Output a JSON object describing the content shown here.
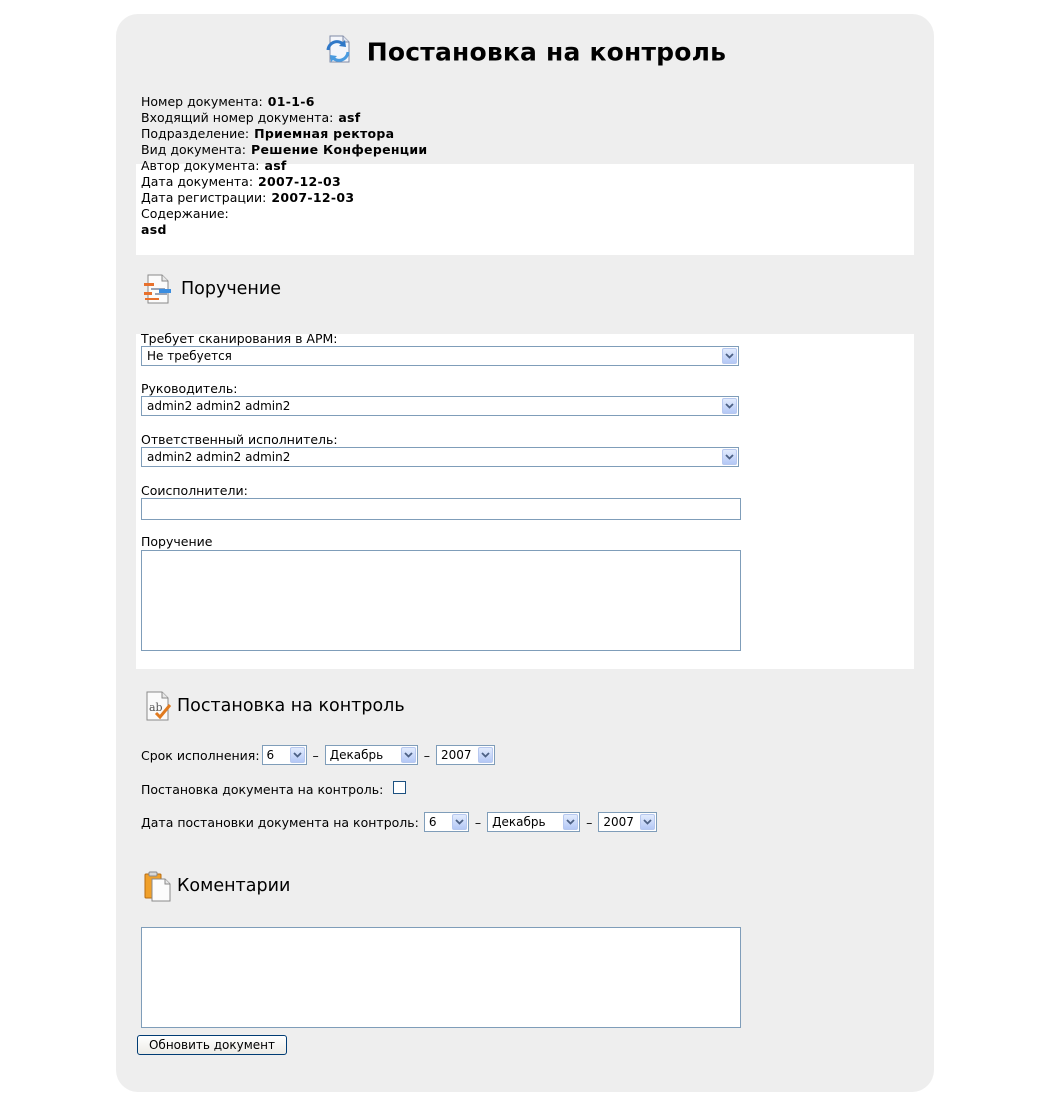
{
  "header": {
    "title": "Постановка на контроль",
    "icon": "document-refresh-icon"
  },
  "document_info": {
    "fields": [
      {
        "label": "Номер документа:",
        "value": "01-1-6"
      },
      {
        "label": "Входящий номер документа:",
        "value": "asf"
      },
      {
        "label": "Подразделение:",
        "value": "Приемная ректора"
      },
      {
        "label": "Вид документа:",
        "value": "Решение Конференции"
      },
      {
        "label": "Автор документа:",
        "value": "asf"
      },
      {
        "label": "Дата документа:",
        "value": "2007-12-03"
      },
      {
        "label": "Дата регистрации:",
        "value": "2007-12-03"
      }
    ],
    "content_label": "Содержание:",
    "content_value": "asd"
  },
  "assignment": {
    "heading": "Поручение",
    "icon": "document-edit-icon",
    "scan_label": "Требует сканирования в АРМ:",
    "scan_value": "Не требуется",
    "manager_label": "Руководитель:",
    "manager_value": "admin2 admin2 admin2",
    "executor_label": "Ответственный исполнитель:",
    "executor_value": "admin2 admin2 admin2",
    "coexecutors_label": "Соисполнители:",
    "coexecutors_value": "",
    "order_label": "Поручение",
    "order_value": ""
  },
  "control": {
    "heading": "Постановка на контроль",
    "icon": "spellcheck-icon",
    "deadline_label": "Срок исполнения:",
    "deadline_day": "6",
    "deadline_month": "Декабрь",
    "deadline_year": "2007",
    "dash": "–",
    "put_on_control_label": "Постановка документа на контроль:",
    "put_on_control_checked": false,
    "control_date_label": "Дата постановки документа на контроль:",
    "control_day": "6",
    "control_month": "Декабрь",
    "control_year": "2007"
  },
  "comments": {
    "heading": "Коментарии",
    "icon": "clipboard-icon",
    "value": ""
  },
  "actions": {
    "submit_label": "Обновить документ"
  },
  "colors": {
    "panel_bg": "#eeeeee",
    "field_border": "#7f9db9",
    "button_border": "#003c74"
  }
}
